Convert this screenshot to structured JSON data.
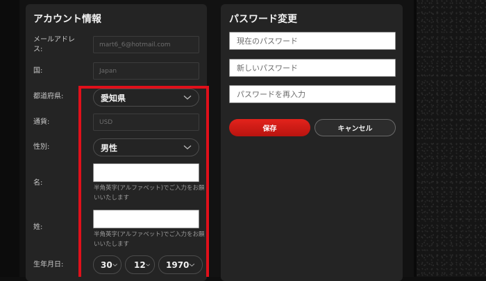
{
  "account": {
    "title": "アカウント情報",
    "email": {
      "label": "メールアドレス:",
      "value": "mart6_6@hotmail.com"
    },
    "country": {
      "label": "国:",
      "value": "Japan"
    },
    "prefecture": {
      "label": "都道府県:",
      "value": "愛知県"
    },
    "currency": {
      "label": "通貨:",
      "value": "USD"
    },
    "gender": {
      "label": "性別:",
      "value": "男性"
    },
    "first_name": {
      "label": "名:",
      "value": "",
      "hint": "半角英字(アルファベット)でご入力をお願いいたします"
    },
    "last_name": {
      "label": "姓:",
      "value": "",
      "hint": "半角英字(アルファベット)でご入力をお願いいたします"
    },
    "birthdate": {
      "label": "生年月日:",
      "day": "30",
      "month": "12",
      "year": "1970"
    }
  },
  "password": {
    "title": "パスワード変更",
    "current_placeholder": "現在のパスワード",
    "new_placeholder": "新しいパスワード",
    "confirm_placeholder": "パスワードを再入力",
    "save_label": "保存",
    "cancel_label": "キャンセル"
  },
  "colors": {
    "accent": "#e0101a",
    "panel": "#242424",
    "save_button": "#d41e17"
  }
}
